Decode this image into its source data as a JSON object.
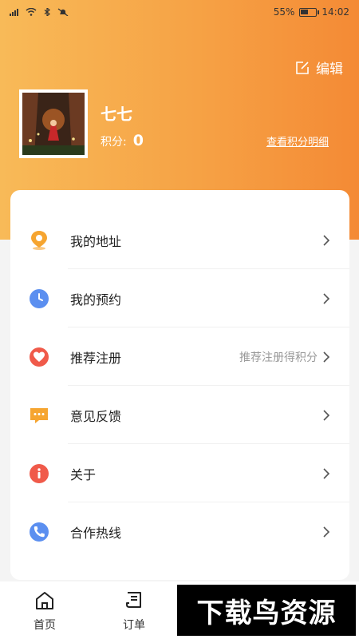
{
  "status_bar": {
    "battery_percent": "55%",
    "time": "14:02",
    "battery_level": 0.55
  },
  "header": {
    "edit_label": "编辑"
  },
  "profile": {
    "name": "七七",
    "points_label": "积分:",
    "points_value": "0",
    "points_detail_link": "查看积分明细"
  },
  "menu": [
    {
      "label": "我的地址",
      "icon": "location-icon",
      "color": "#f6a530",
      "hint": ""
    },
    {
      "label": "我的预约",
      "icon": "clock-icon",
      "color": "#5b8ff0",
      "hint": ""
    },
    {
      "label": "推荐注册",
      "icon": "heart-icon",
      "color": "#f05a4a",
      "hint": "推荐注册得积分"
    },
    {
      "label": "意见反馈",
      "icon": "message-icon",
      "color": "#f6a530",
      "hint": ""
    },
    {
      "label": "关于",
      "icon": "info-icon",
      "color": "#f05a4a",
      "hint": ""
    },
    {
      "label": "合作热线",
      "icon": "phone-icon",
      "color": "#5b8ff0",
      "hint": ""
    }
  ],
  "tabbar": {
    "home": "首页",
    "orders": "订单"
  },
  "watermark": "下载鸟资源"
}
